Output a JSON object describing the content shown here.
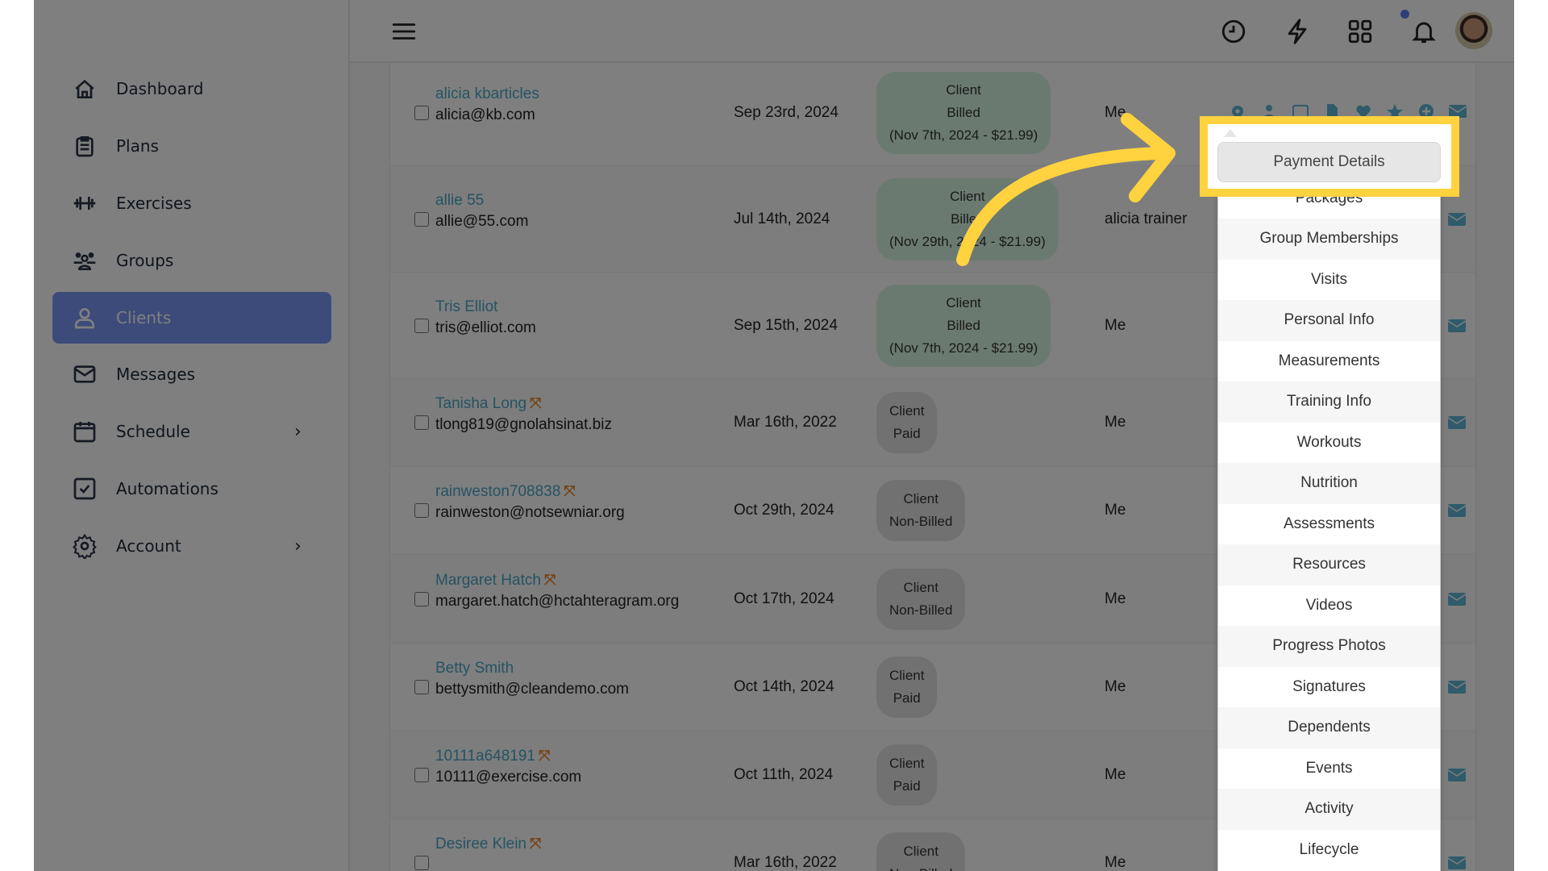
{
  "sidebar": {
    "items": [
      {
        "label": "Dashboard",
        "icon": "home-icon"
      },
      {
        "label": "Plans",
        "icon": "clipboard-icon"
      },
      {
        "label": "Exercises",
        "icon": "dumbbell-icon"
      },
      {
        "label": "Groups",
        "icon": "users-icon"
      },
      {
        "label": "Clients",
        "icon": "user-icon",
        "active": true
      },
      {
        "label": "Messages",
        "icon": "envelope-icon"
      },
      {
        "label": "Schedule",
        "icon": "calendar-icon",
        "chevron": true
      },
      {
        "label": "Automations",
        "icon": "checkbox-icon"
      },
      {
        "label": "Account",
        "icon": "gear-icon",
        "chevron": true
      }
    ]
  },
  "header": {
    "icons": [
      "menu-icon",
      "clock-icon",
      "lightning-icon",
      "grid-icon",
      "bell-icon",
      "avatar"
    ],
    "notification_dot_color": "#5a7cf0"
  },
  "clients": [
    {
      "name": "alicia kbarticles",
      "email": "alicia@kb.com",
      "date": "Sep 23rd, 2024",
      "status": [
        "Client",
        "Billed",
        "(Nov 7th, 2024 - $21.99)"
      ],
      "trainer": "Me",
      "billed": true,
      "linked": false
    },
    {
      "name": "allie 55",
      "email": "allie@55.com",
      "date": "Jul 14th, 2024",
      "status": [
        "Client",
        "Billed",
        "(Nov 29th, 2024 - $21.99)"
      ],
      "trainer": "alicia trainer",
      "billed": true,
      "linked": false
    },
    {
      "name": "Tris Elliot",
      "email": "tris@elliot.com",
      "date": "Sep 15th, 2024",
      "status": [
        "Client",
        "Billed",
        "(Nov 7th, 2024 - $21.99)"
      ],
      "trainer": "Me",
      "billed": true,
      "linked": false
    },
    {
      "name": "Tanisha Long",
      "email": "tlong819@gnolahsinat.biz",
      "date": "Mar 16th, 2022",
      "status": [
        "Client",
        "Paid"
      ],
      "trainer": "Me",
      "billed": false,
      "linked": true
    },
    {
      "name": "rainweston708838",
      "email": "rainweston@notsewniar.org",
      "date": "Oct 29th, 2024",
      "status": [
        "Client",
        "Non-Billed"
      ],
      "trainer": "Me",
      "billed": false,
      "linked": true
    },
    {
      "name": "Margaret Hatch",
      "email": "margaret.hatch@hctahteragram.org",
      "date": "Oct 17th, 2024",
      "status": [
        "Client",
        "Non-Billed"
      ],
      "trainer": "Me",
      "billed": false,
      "linked": true
    },
    {
      "name": "Betty Smith",
      "email": "bettysmith@cleandemo.com",
      "date": "Oct 14th, 2024",
      "status": [
        "Client",
        "Paid"
      ],
      "trainer": "Me",
      "billed": false,
      "linked": false
    },
    {
      "name": "10111a648191",
      "email": "10111@exercise.com",
      "date": "Oct 11th, 2024",
      "status": [
        "Client",
        "Paid"
      ],
      "trainer": "Me",
      "billed": false,
      "linked": true
    },
    {
      "name": "Desiree Klein",
      "email": "",
      "date": "Mar 16th, 2022",
      "status": [
        "Client",
        "Non-Billed"
      ],
      "trainer": "Me",
      "billed": false,
      "linked": true
    }
  ],
  "row_action_icons": [
    "gear-icon",
    "user-icon",
    "calendar-check-icon",
    "file-icon",
    "heartbeat-icon",
    "star-icon",
    "plus-circle-icon",
    "envelope-icon"
  ],
  "dropdown": {
    "highlighted": "Payment Details",
    "items": [
      "Payment Details",
      "Packages",
      "Group Memberships",
      "Visits",
      "Personal Info",
      "Measurements",
      "Training Info",
      "Workouts",
      "Nutrition",
      "Assessments",
      "Resources",
      "Videos",
      "Progress Photos",
      "Signatures",
      "Dependents",
      "Events",
      "Activity",
      "Lifecycle"
    ]
  },
  "colors": {
    "highlight": "#FFD23F",
    "accent": "#7a96f4",
    "link": "#4aa6c6"
  }
}
